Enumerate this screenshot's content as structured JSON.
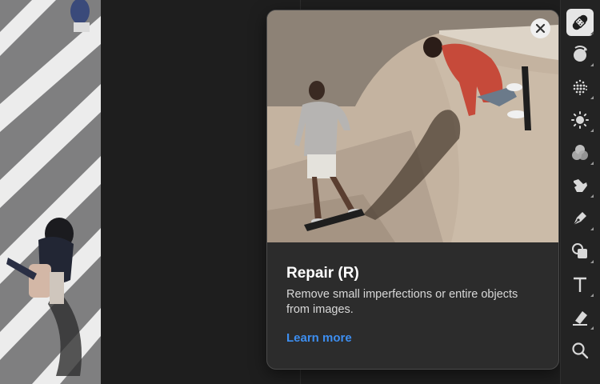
{
  "tip": {
    "title": "Repair (R)",
    "description": "Remove small imperfections or entire objects from images.",
    "link": "Learn more"
  },
  "toolbar": {
    "tools": [
      {
        "name": "repair-tool",
        "icon": "bandage-icon",
        "active": true
      },
      {
        "name": "adjust-color-tool",
        "icon": "circle-arrows-icon"
      },
      {
        "name": "grain-tool",
        "icon": "dotted-sphere-icon"
      },
      {
        "name": "light-tool",
        "icon": "sun-icon"
      },
      {
        "name": "blend-tool",
        "icon": "overlapping-circles-icon"
      },
      {
        "name": "smudge-tool",
        "icon": "hand-brush-icon"
      },
      {
        "name": "pen-tool",
        "icon": "pen-nib-icon"
      },
      {
        "name": "shape-tool",
        "icon": "shapes-icon"
      },
      {
        "name": "text-tool",
        "icon": "text-icon"
      },
      {
        "name": "eraser-tool",
        "icon": "eraser-icon"
      },
      {
        "name": "zoom-tool",
        "icon": "magnifier-icon"
      }
    ]
  },
  "colors": {
    "accent": "#3d8ef0",
    "panel": "#2c2c2c",
    "background": "#1e1e1e"
  }
}
